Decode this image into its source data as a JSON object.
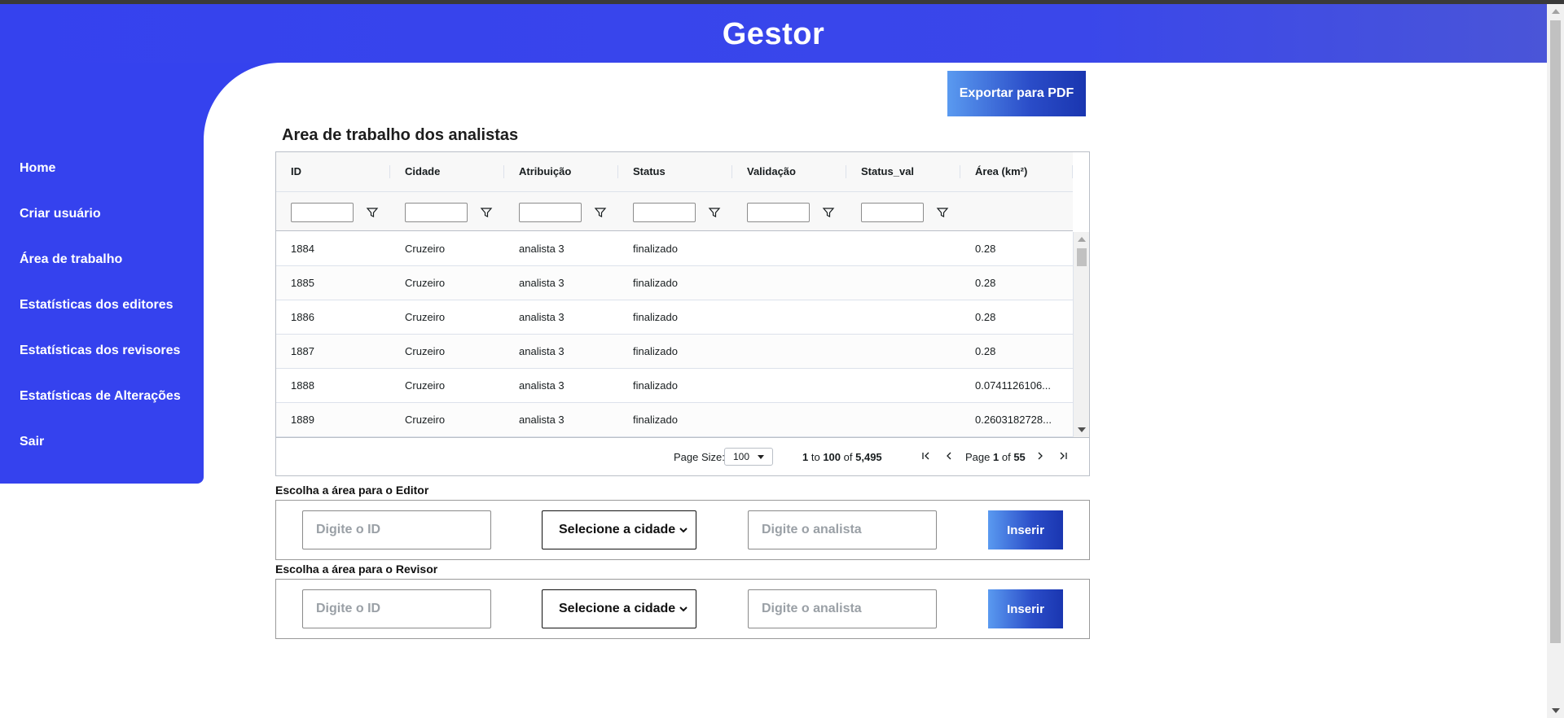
{
  "header": {
    "title": "Gestor"
  },
  "sidebar": {
    "items": [
      {
        "label": "Home"
      },
      {
        "label": "Criar usuário"
      },
      {
        "label": "Área de trabalho"
      },
      {
        "label": "Estatísticas dos editores"
      },
      {
        "label": "Estatísticas dos revisores"
      },
      {
        "label": "Estatísticas de Alterações"
      },
      {
        "label": "Sair"
      }
    ]
  },
  "main": {
    "export_label": "Exportar para PDF",
    "title": "Area de trabalho dos analistas"
  },
  "grid": {
    "columns": [
      "ID",
      "Cidade",
      "Atribuição",
      "Status",
      "Validação",
      "Status_val",
      "Área (km²)"
    ],
    "rows": [
      [
        "1884",
        "Cruzeiro",
        "analista 3",
        "finalizado",
        "",
        "",
        "0.28"
      ],
      [
        "1885",
        "Cruzeiro",
        "analista 3",
        "finalizado",
        "",
        "",
        "0.28"
      ],
      [
        "1886",
        "Cruzeiro",
        "analista 3",
        "finalizado",
        "",
        "",
        "0.28"
      ],
      [
        "1887",
        "Cruzeiro",
        "analista 3",
        "finalizado",
        "",
        "",
        "0.28"
      ],
      [
        "1888",
        "Cruzeiro",
        "analista 3",
        "finalizado",
        "",
        "",
        "0.0741126106..."
      ],
      [
        "1889",
        "Cruzeiro",
        "analista 3",
        "finalizado",
        "",
        "",
        "0.2603182728..."
      ]
    ],
    "pagination": {
      "page_size_label": "Page Size:",
      "page_size": "100",
      "from": "1",
      "to_word": "to",
      "to": "100",
      "of_word": "of",
      "total": "5,495",
      "page_word": "Page",
      "page": "1",
      "page_of": "of",
      "pages": "55"
    }
  },
  "editor_form": {
    "label": "Escolha a área para o Editor",
    "id_placeholder": "Digite o ID",
    "city_select": "Selecione a cidade",
    "analyst_placeholder": "Digite o analista",
    "submit": "Inserir"
  },
  "reviewer_form": {
    "label": "Escolha a área para o Revisor",
    "id_placeholder": "Digite o ID",
    "city_select": "Selecione a cidade",
    "analyst_placeholder": "Digite o analista",
    "submit": "Inserir"
  },
  "icons": {
    "filter": "filter-icon",
    "first_page": "first-page-icon",
    "prev_page": "prev-page-icon",
    "next_page": "next-page-icon",
    "last_page": "last-page-icon"
  },
  "colors": {
    "brand": "#3542ee",
    "button_gradient_start": "#5a9af0",
    "button_gradient_end": "#1a36b0"
  }
}
